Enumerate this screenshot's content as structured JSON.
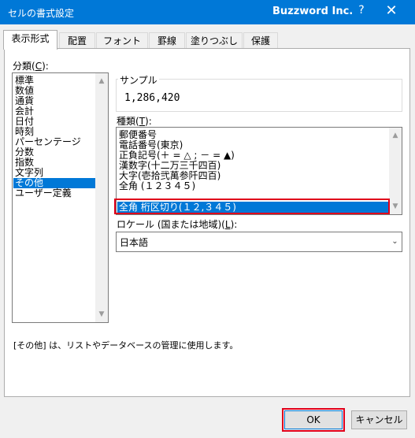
{
  "window": {
    "title": "セルの書式設定",
    "brand": "Buzzword Inc.",
    "help_label": "?",
    "close_label": "✕"
  },
  "tabs": [
    {
      "label": "表示形式",
      "active": true
    },
    {
      "label": "配置"
    },
    {
      "label": "フォント"
    },
    {
      "label": "罫線"
    },
    {
      "label": "塗りつぶし"
    },
    {
      "label": "保護"
    }
  ],
  "category": {
    "label_prefix": "分類(",
    "label_key": "C",
    "label_suffix": "):",
    "items": [
      "標準",
      "数値",
      "通貨",
      "会計",
      "日付",
      "時刻",
      "パーセンテージ",
      "分数",
      "指数",
      "文字列",
      "その他",
      "ユーザー定義"
    ],
    "selected": "その他"
  },
  "sample": {
    "label": "サンプル",
    "value": "1,286,420"
  },
  "type": {
    "label_prefix": "種類(",
    "label_key": "T",
    "label_suffix": "):",
    "items": [
      "郵便番号",
      "電話番号(東京)",
      "正負記号(＋ = △ ; － = ▲)",
      "漢数字(十二万三千四百)",
      "大字(壱拾弐萬参阡四百)",
      "全角 (１２３４５)",
      "全角 桁区切り(１２,３４５)"
    ],
    "selected": "全角 桁区切り(１２,３４５)"
  },
  "locale": {
    "label_prefix": "ロケール (国または地域)(",
    "label_key": "L",
    "label_suffix": "):",
    "value": "日本語"
  },
  "description": "[その他] は、リストやデータベースの管理に使用します。",
  "buttons": {
    "ok": "OK",
    "cancel": "キャンセル"
  },
  "icons": {
    "scroll_up": "up-arrow-icon",
    "scroll_down": "down-arrow-icon",
    "combo": "chevron-down-icon"
  },
  "colors": {
    "titlebar": "#0078d7",
    "selection": "#0078d7",
    "highlight": "#e0001b"
  }
}
